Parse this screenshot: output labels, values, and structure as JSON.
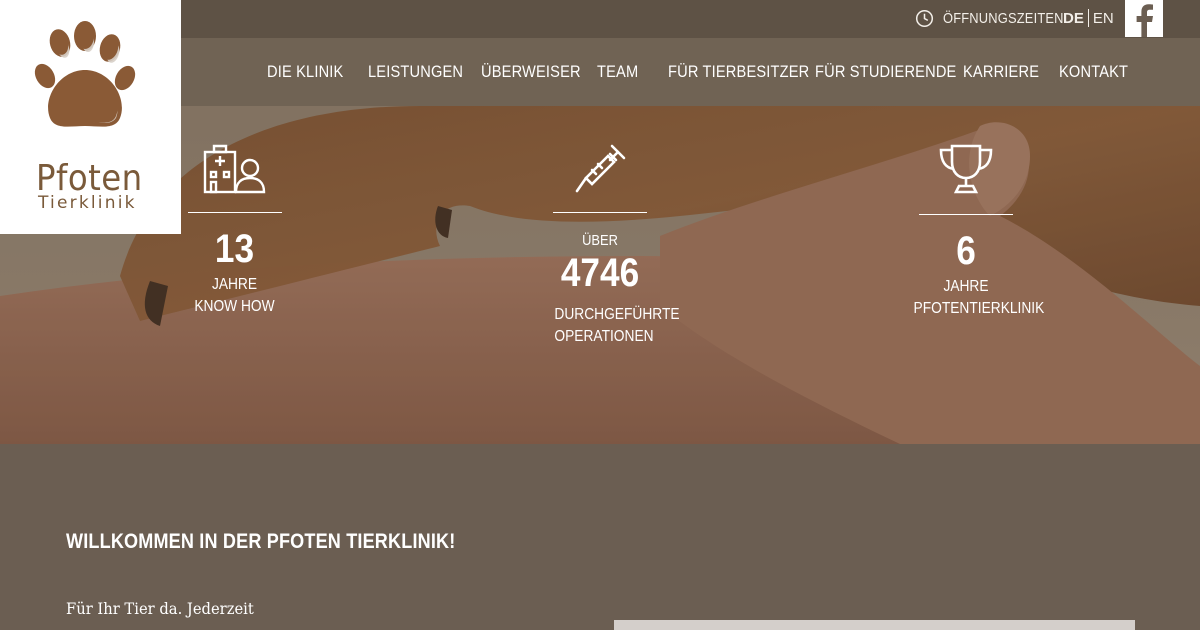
{
  "brand": {
    "name": "Pfoten",
    "subtitle": "Tierklinik",
    "paw_color": "#8a5a36"
  },
  "topbar": {
    "hours_label": "ÖFFNUNGSZEITEN",
    "lang_active": "DE",
    "lang_other": "EN"
  },
  "nav": {
    "items": [
      {
        "label": "DIE KLINIK"
      },
      {
        "label": "LEISTUNGEN"
      },
      {
        "label": "ÜBERWEISER"
      },
      {
        "label": "TEAM"
      },
      {
        "label": "FÜR TIERBESITZER"
      },
      {
        "label": "FÜR STUDIERENDE"
      },
      {
        "label": "KARRIERE"
      },
      {
        "label": "KONTAKT"
      }
    ]
  },
  "stats": [
    {
      "icon": "hospital-icon",
      "value": "13",
      "label_line1": "JAHRE",
      "label_line2": "KNOW HOW"
    },
    {
      "icon": "syringe-icon",
      "prefix": "ÜBER",
      "value": "4746",
      "label_line1": "DURCHGEFÜHRTE",
      "label_line2": "OPERATIONEN"
    },
    {
      "icon": "trophy-icon",
      "value": "6",
      "label_line1": "JAHRE",
      "label_line2": "PFOTENTIERKLINIK"
    }
  ],
  "content": {
    "welcome": "WILLKOMMEN IN DER PFOTEN TIERKLINIK!",
    "tagline": "Für Ihr Tier da. Jederzeit"
  },
  "colors": {
    "topbar": "#5e5245",
    "navbar": "#706354",
    "content_bg": "#6b5e52",
    "text": "#ffffff"
  }
}
